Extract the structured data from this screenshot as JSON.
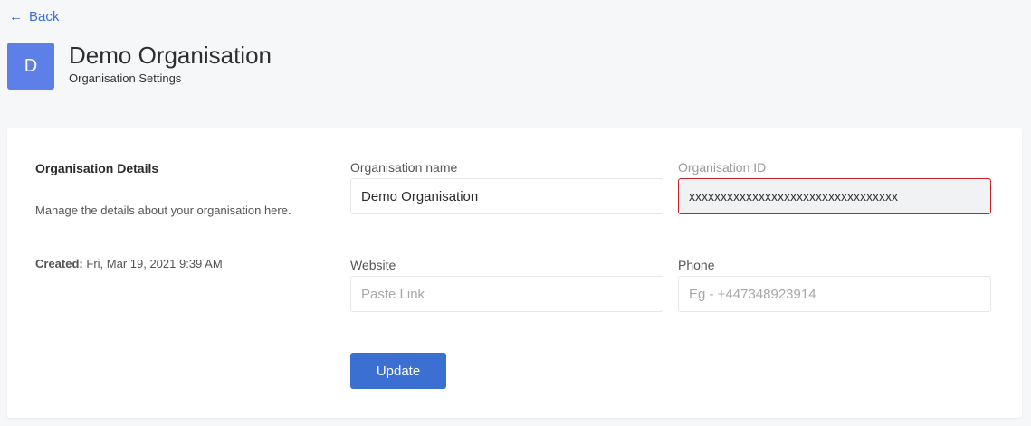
{
  "nav": {
    "back_label": "Back",
    "back_icon": "arrow-left-icon"
  },
  "header": {
    "avatar_letter": "D",
    "avatar_color": "#5d7fe8",
    "title": "Demo Organisation",
    "subtitle": "Organisation Settings"
  },
  "details": {
    "title": "Organisation Details",
    "description": "Manage the details about your organisation here.",
    "created_label": "Created:",
    "created_value": "Fri, Mar 19, 2021 9:39 AM"
  },
  "form": {
    "name_label": "Organisation name",
    "name_value": "Demo Organisation",
    "id_label": "Organisation ID",
    "id_value": "xxxxxxxxxxxxxxxxxxxxxxxxxxxxxxxxx",
    "website_label": "Website",
    "website_placeholder": "Paste Link",
    "phone_label": "Phone",
    "phone_placeholder": "Eg - +447348923914",
    "update_label": "Update"
  },
  "colors": {
    "accent": "#3b6fd1",
    "error_border": "#c7222a",
    "page_bg": "#f6f7f8"
  }
}
